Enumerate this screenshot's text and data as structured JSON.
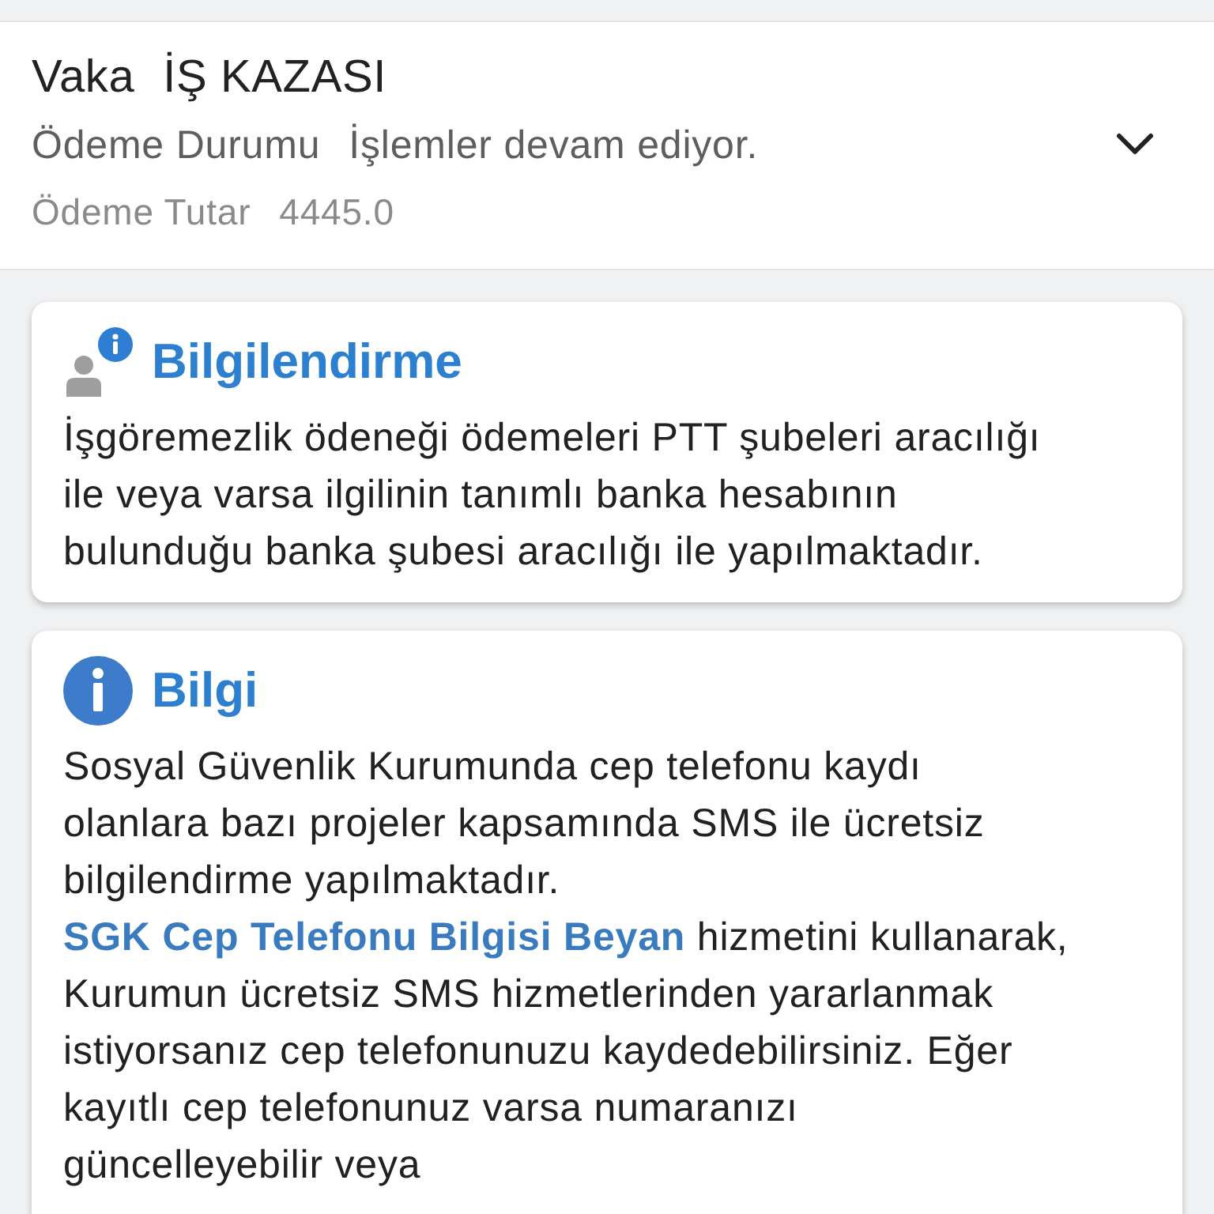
{
  "header": {
    "case_label": "Vaka",
    "case_value": "İŞ KAZASI",
    "fields": [
      {
        "label": "Ödeme Durumu",
        "value": "İşlemler devam ediyor."
      },
      {
        "label": "Ödeme Tutar",
        "value": "4445.0"
      }
    ],
    "expanded": false
  },
  "cards": [
    {
      "kind": "notice",
      "title": "Bilgilendirme",
      "parts": [
        {
          "kind": "text",
          "text": "İşgöremezlik ödeneği ödemeleri PTT şubeleri aracılığı ile veya varsa ilgilinin tanımlı banka hesabının bulunduğu banka şubesi aracılığı ile yapılmaktadır."
        }
      ]
    },
    {
      "kind": "info",
      "title": "Bilgi",
      "parts": [
        {
          "kind": "text",
          "text": "Sosyal Güvenlik Kurumunda cep telefonu kaydı olanlara bazı projeler kapsamında SMS ile ücretsiz bilgilendirme yapılmaktadır. "
        },
        {
          "kind": "link",
          "text": "SGK Cep Telefonu Bilgisi Beyan"
        },
        {
          "kind": "text",
          "text": " hizmetini kullanarak, Kurumun ücretsiz SMS hizmetlerinden yararlanmak istiyorsanız cep telefonunuzu kaydedebilirsiniz. Eğer kayıtlı cep telefonunuz varsa numaranızı güncelleyebilir veya"
        }
      ]
    }
  ]
}
